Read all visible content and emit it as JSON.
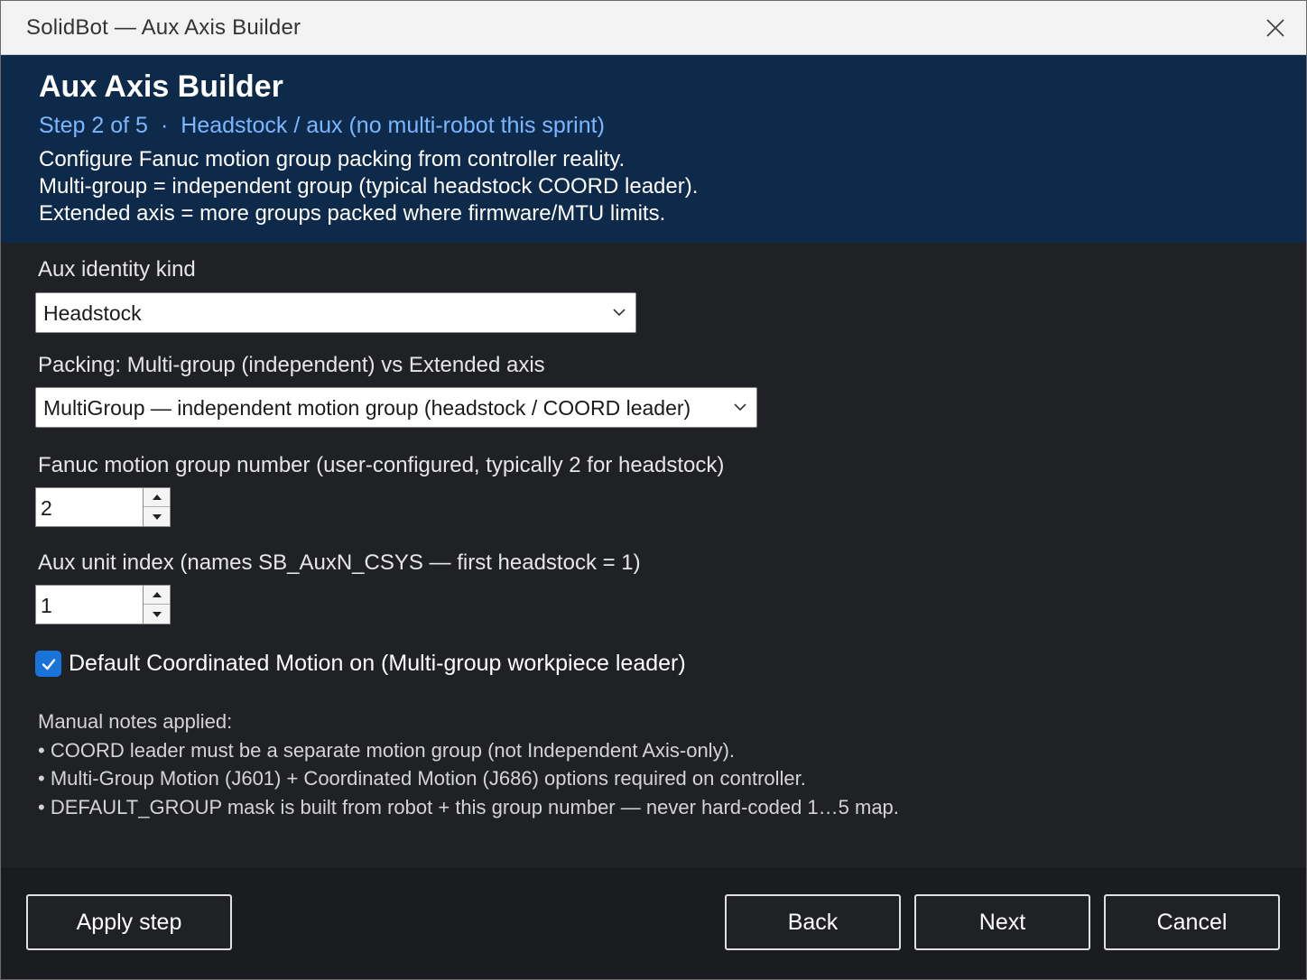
{
  "window": {
    "title": "SolidBot — Aux Axis Builder"
  },
  "header": {
    "title": "Aux Axis Builder",
    "step": "Step 2 of 5",
    "step_separator": "·",
    "step_context": "Headstock / aux (no multi-robot this sprint)",
    "description": [
      "Configure Fanuc motion group packing from controller reality.",
      "Multi-group = independent group (typical headstock COORD leader).",
      "Extended axis = more groups packed where firmware/MTU limits."
    ],
    "background_color": "#0e2a4a",
    "accent_color": "#7cb6ff"
  },
  "form": {
    "identity": {
      "label": "Aux identity kind",
      "value": "Headstock"
    },
    "packing": {
      "label": "Packing: Multi-group (independent) vs Extended axis",
      "value": "MultiGroup — independent motion group (headstock / COORD leader)"
    },
    "group_number": {
      "label": "Fanuc motion group number (user-configured, typically 2 for headstock)",
      "value": "2"
    },
    "unit_index": {
      "label": "Aux unit index (names SB_AuxN_CSYS — first headstock = 1)",
      "value": "1"
    },
    "coord_motion": {
      "label": "Default Coordinated Motion on (Multi-group workpiece leader)",
      "checked": true,
      "color": "#1a73d9"
    }
  },
  "notes": {
    "heading": "Manual notes applied:",
    "items": [
      "COORD leader must be a separate motion group (not Independent Axis-only).",
      "Multi-Group Motion (J601) + Coordinated Motion (J686) options required on controller.",
      "DEFAULT_GROUP mask is built from robot + this group number — never hard-coded 1…5 map."
    ]
  },
  "footer": {
    "apply_label": "Apply step",
    "back_label": "Back",
    "next_label": "Next",
    "cancel_label": "Cancel"
  },
  "icons": {
    "close": "close-icon",
    "dropdown": "chevron-down-icon",
    "spin_up": "spin-up-icon",
    "spin_down": "spin-down-icon",
    "check": "checkmark-icon"
  }
}
